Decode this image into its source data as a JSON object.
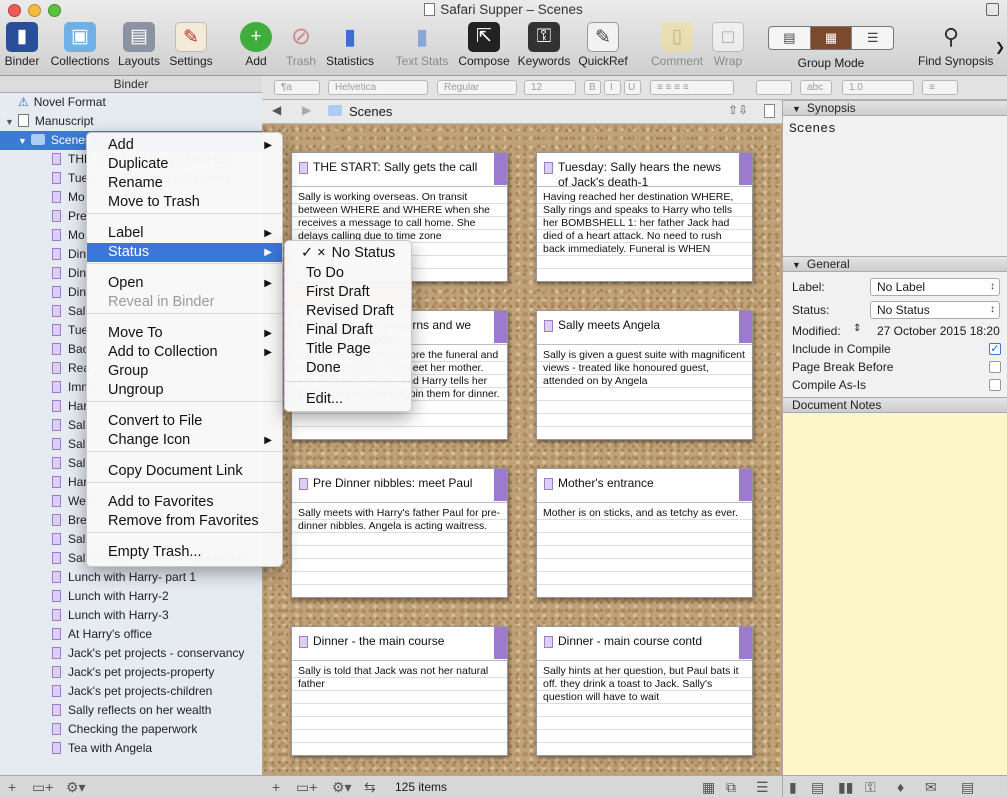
{
  "window": {
    "title": "Safari Supper – Scenes"
  },
  "toolbar": {
    "items": [
      {
        "label": "Binder",
        "icon": "binder-icon"
      },
      {
        "label": "Collections",
        "icon": "folder-icon"
      },
      {
        "label": "Layouts",
        "icon": "layouts-icon"
      },
      {
        "label": "Settings",
        "icon": "settings-icon"
      },
      {
        "label": "Add",
        "icon": "add-icon"
      },
      {
        "label": "Trash",
        "icon": "trash-icon"
      },
      {
        "label": "Statistics",
        "icon": "statistics-icon"
      },
      {
        "label": "Text Stats",
        "icon": "text-stats-icon"
      },
      {
        "label": "Compose",
        "icon": "compose-icon"
      },
      {
        "label": "Keywords",
        "icon": "keywords-icon"
      },
      {
        "label": "QuickRef",
        "icon": "quickref-icon"
      },
      {
        "label": "Comment",
        "icon": "comment-icon"
      },
      {
        "label": "Wrap",
        "icon": "wrap-icon"
      },
      {
        "label": "Group Mode",
        "icon": "group-mode-icon"
      },
      {
        "label": "Find Synopsis",
        "icon": "find-synopsis-icon"
      }
    ],
    "overflow": "❯"
  },
  "format_bar": {
    "font": "Helvetica",
    "style": "Regular",
    "size": "12",
    "bold": "B",
    "italic": "I",
    "spacing": "1.0"
  },
  "binder": {
    "header": "Binder",
    "novel_format": "Novel Format",
    "manuscript": "Manuscript",
    "scenes": "Scenes",
    "items": [
      "THE START: Sally gets the call",
      "Tuesday: Sally hears the news",
      "Mo",
      "Pre",
      "Mo",
      "Din",
      "Din",
      "Din",
      "Sall",
      "Tue",
      "Bac",
      "Rea",
      "Imm",
      "Har",
      "Sall",
      "Sall",
      "Sall",
      "Har",
      "Wee",
      "Bre",
      "Sall",
      "Sally unpacks and is then collecte...",
      "Lunch with Harry- part 1",
      "Lunch with Harry-2",
      "Lunch with Harry-3",
      "At Harry's office",
      "Jack's pet projects - conservancy",
      "Jack's pet projects-property",
      "Jack's pet projects-children",
      "Sally reflects on her wealth",
      "Checking the paperwork",
      "Tea with Angela"
    ]
  },
  "editor": {
    "path": "Scenes",
    "status": "125 items",
    "cards": [
      {
        "title": "THE START: Sally gets the call",
        "body": "Sally is working overseas. On transit between WHERE and WHERE when she receives a message to call home. She delays calling due to time zone"
      },
      {
        "title": "Tuesday: Sally hears the news of Jack's death-1",
        "body": "Having reached her destination WHERE, Sally rings and speaks to Harry who tells her BOMBSHELL 1: her father Jack had died of a heart attack. No need to rush back immediately. Funeral is WHEN"
      },
      {
        "title": "Monday: Sally returns and we meet her mother",
        "body": "Sally arrives the day before the funeral and meets her mother. We meet her mother. Her mother is resting, and Harry tells her that Harry's mother will join them for dinner."
      },
      {
        "title": "Sally meets Angela",
        "body": "Sally is given a guest suite with magnificent views - treated like honoured guest, attended on by Angela"
      },
      {
        "title": "Pre Dinner nibbles: meet Paul",
        "body": "Sally meets with Harry's father Paul for pre-dinner nibbles. Angela is acting waitress."
      },
      {
        "title": "Mother's entrance",
        "body": "Mother is on sticks, and as tetchy as ever."
      },
      {
        "title": "Dinner - the main course",
        "body": "Sally is told that Jack was not her natural father"
      },
      {
        "title": "Dinner - main course contd",
        "body": "Sally hints at her question, but Paul bats it off. they drink a toast to Jack. Sally's question will have to wait"
      }
    ]
  },
  "context_menu": {
    "items": [
      {
        "label": "Add",
        "submenu": true
      },
      {
        "label": "Duplicate"
      },
      {
        "label": "Rename"
      },
      {
        "label": "Move to Trash"
      },
      {
        "label": "Label",
        "submenu": true
      },
      {
        "label": "Status",
        "submenu": true,
        "selected": true
      },
      {
        "label": "Open",
        "submenu": true
      },
      {
        "label": "Reveal in Binder",
        "disabled": true
      },
      {
        "label": "Move To",
        "submenu": true
      },
      {
        "label": "Add to Collection",
        "submenu": true
      },
      {
        "label": "Group"
      },
      {
        "label": "Ungroup"
      },
      {
        "label": "Convert to File"
      },
      {
        "label": "Change Icon",
        "submenu": true
      },
      {
        "label": "Copy Document Link"
      },
      {
        "label": "Add to Favorites"
      },
      {
        "label": "Remove from Favorites"
      },
      {
        "label": "Empty Trash..."
      }
    ]
  },
  "status_submenu": {
    "check": "✓",
    "no_status_mark": "×",
    "items": [
      "No Status",
      "To Do",
      "First Draft",
      "Revised Draft",
      "Final Draft",
      "Title Page",
      "Done",
      "Edit..."
    ],
    "checked": "No Status"
  },
  "inspector": {
    "synopsis_header": "Synopsis",
    "synopsis_title": "Scenes",
    "general_header": "General",
    "label_label": "Label:",
    "label_value": "No Label",
    "status_label": "Status:",
    "status_value": "No Status",
    "modified_label": "Modified:",
    "modified_value": "27 October 2015 18:20",
    "include_label": "Include in Compile",
    "include_checked": true,
    "page_break_label": "Page Break Before",
    "page_break_checked": false,
    "compile_as_is_label": "Compile As-Is",
    "compile_as_is_checked": false,
    "notes_header": "Document Notes"
  },
  "colors": {
    "accent": "#3b76d9",
    "label_purple": "#9c7ad0",
    "notes_bg": "#fdf6c8",
    "corkboard": "#c0a279"
  }
}
